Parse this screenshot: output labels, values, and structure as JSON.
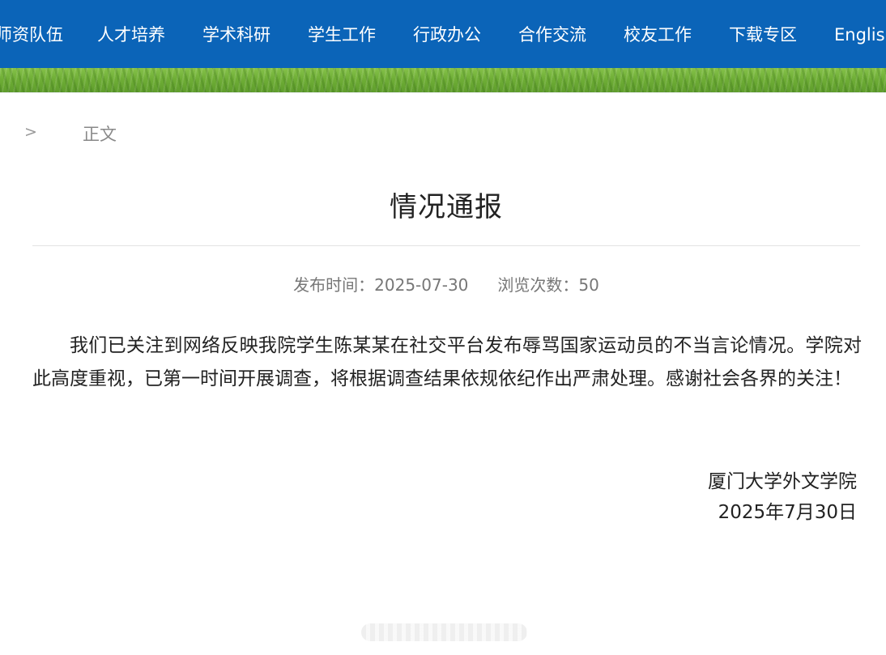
{
  "nav": {
    "items": [
      "师资队伍",
      "人才培养",
      "学术科研",
      "学生工作",
      "行政办公",
      "合作交流",
      "校友工作",
      "下载专区",
      "English"
    ]
  },
  "colors": {
    "nav_bg": "#0b64b8",
    "nav_text": "#ffffff",
    "grass": "#6fae36"
  },
  "breadcrumb": {
    "separator": ">",
    "current": "正文"
  },
  "article": {
    "title": "情况通报",
    "publish_label": "发布时间：",
    "publish_date": "2025-07-30",
    "views_label": "浏览次数：",
    "views": "50",
    "paragraph": "我们已关注到网络反映我院学生陈某某在社交平台发布辱骂国家运动员的不当言论情况。学院对此高度重视，已第一时间开展调查，将根据调查结果依规依纪作出严肃处理。感谢社会各界的关注！",
    "signature_org": "厦门大学外文学院",
    "signature_date": "2025年7月30日"
  }
}
